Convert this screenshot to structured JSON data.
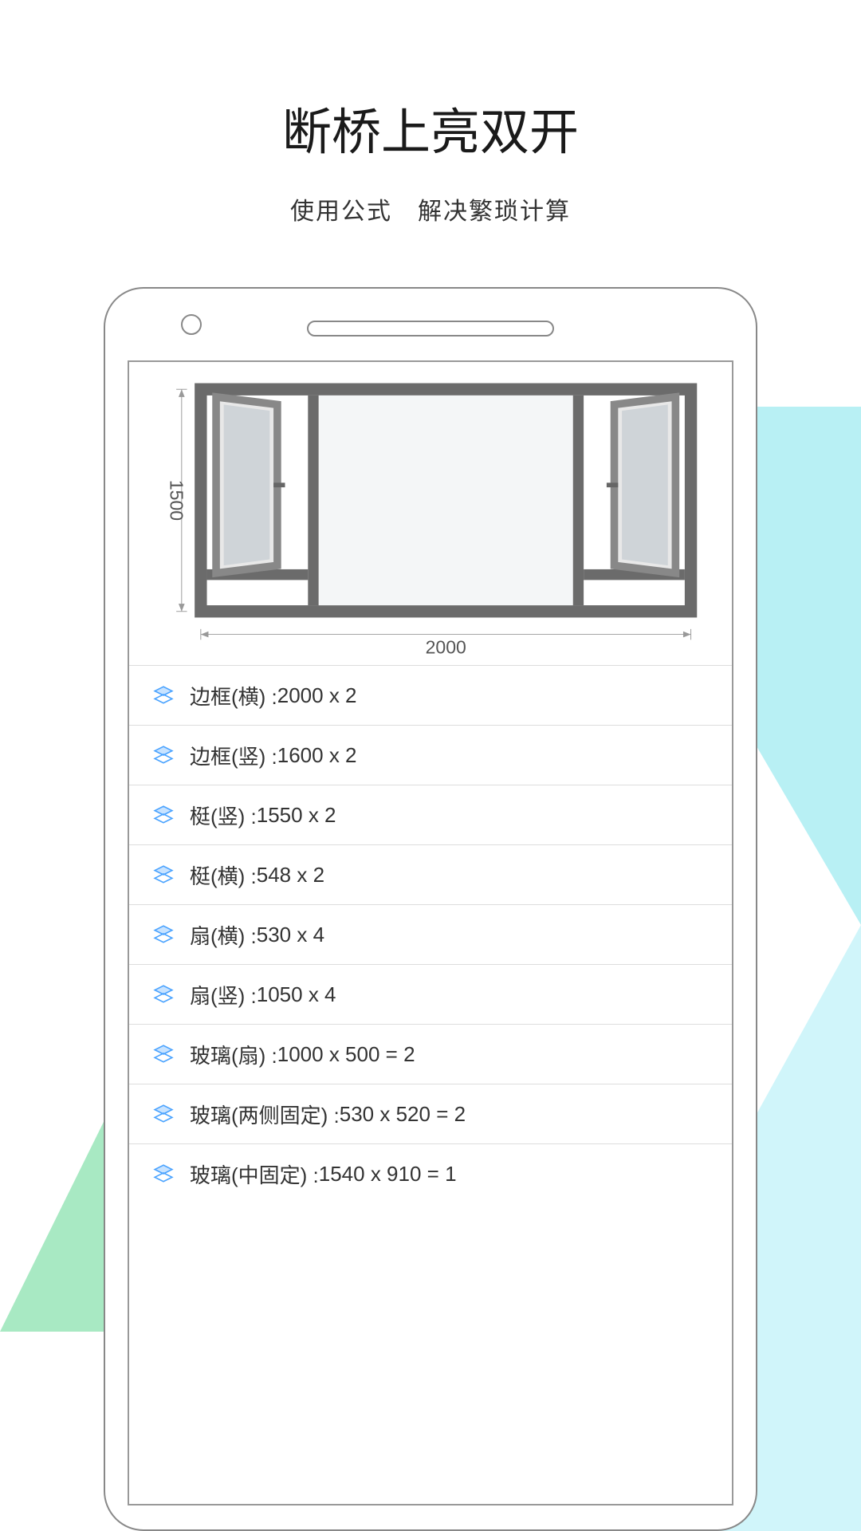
{
  "title": "断桥上亮双开",
  "subtitle": "使用公式　解决繁琐计算",
  "diagram": {
    "height_label": "1500",
    "width_label": "2000"
  },
  "rows": [
    {
      "label": "边框(横) : ",
      "value": "2000 x 2"
    },
    {
      "label": "边框(竖) : ",
      "value": "1600 x 2"
    },
    {
      "label": "梃(竖) : ",
      "value": "1550 x 2"
    },
    {
      "label": "梃(横) : ",
      "value": "548 x 2"
    },
    {
      "label": "扇(横) : ",
      "value": "530 x 4"
    },
    {
      "label": "扇(竖) : ",
      "value": "1050 x 4"
    },
    {
      "label": "玻璃(扇) : ",
      "value": "1000 x 500 = 2"
    },
    {
      "label": "玻璃(两侧固定) : ",
      "value": "530 x 520 = 2"
    },
    {
      "label": "玻璃(中固定) : ",
      "value": "1540 x 910 = 1"
    }
  ]
}
